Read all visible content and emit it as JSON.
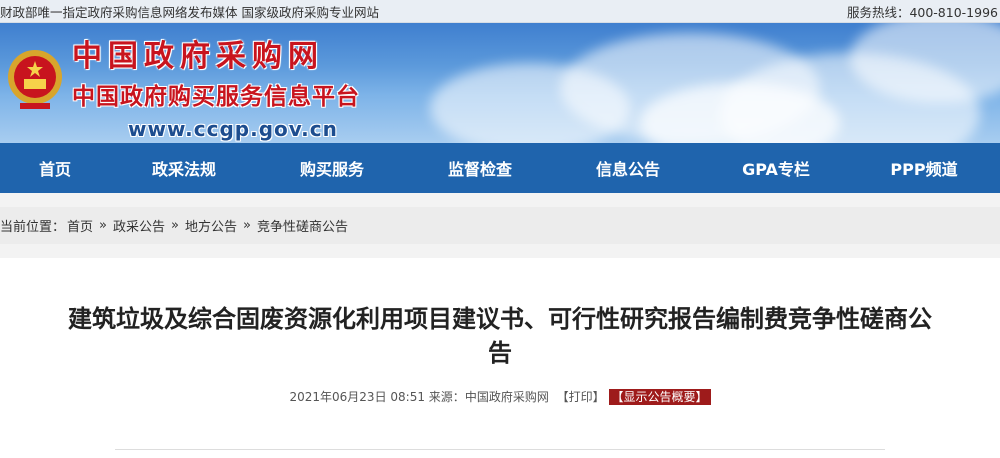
{
  "topbar": {
    "left_text": "财政部唯一指定政府采购信息网络发布媒体 国家级政府采购专业网站",
    "right_text": "服务热线：400-810-1996"
  },
  "header": {
    "logo_line1": "中国政府采购网",
    "logo_line2": "中国政府购买服务信息平台",
    "logo_url": "www.ccgp.gov.cn"
  },
  "nav": {
    "items": [
      "首页",
      "政采法规",
      "购买服务",
      "监督检查",
      "信息公告",
      "GPA专栏",
      "PPP频道"
    ]
  },
  "breadcrumb": {
    "label": "当前位置：",
    "items": [
      "首页",
      "政采公告",
      "地方公告",
      "竞争性磋商公告"
    ],
    "separator": "»"
  },
  "article": {
    "title_line1": "建筑垃圾及综合固废资源化利用项目建议书、可行性研究报告编制费竞争性磋商公",
    "title_line2": "告",
    "date": "2021年06月23日 08:51",
    "source_label": "来源：",
    "source": "中国政府采购网",
    "print_label": "【打印】",
    "summary_label": "【显示公告概要】"
  }
}
